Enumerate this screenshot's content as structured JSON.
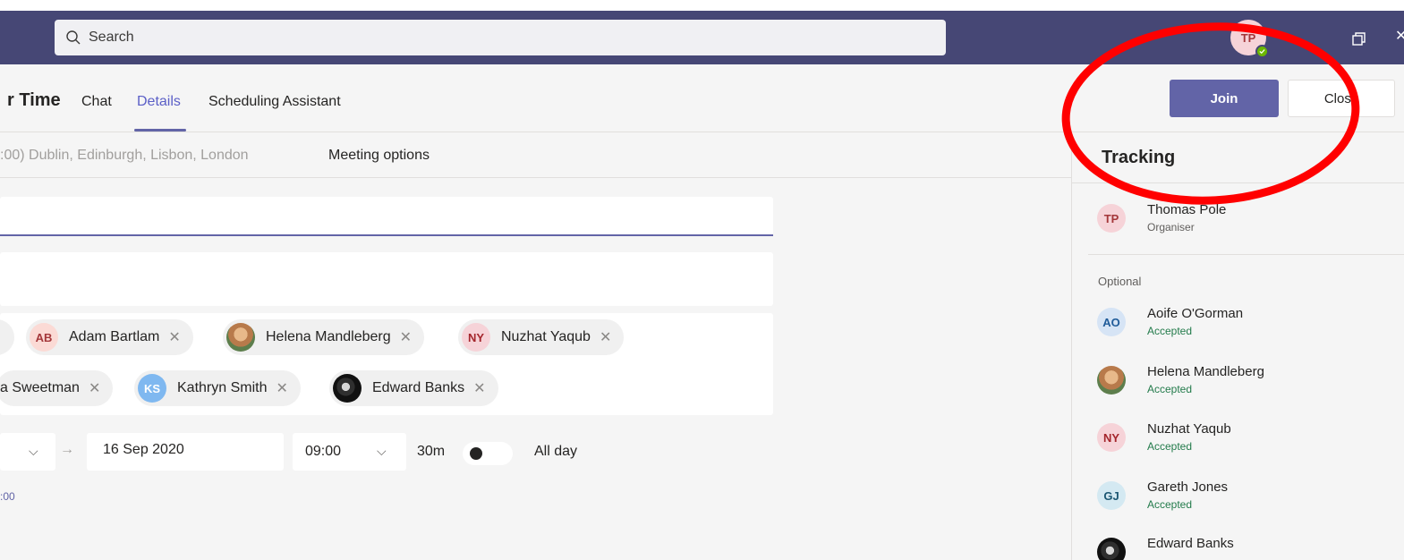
{
  "search": {
    "placeholder": "Search"
  },
  "user": {
    "initials": "TP"
  },
  "header": {
    "title": "r Time",
    "tabs": [
      {
        "label": "Chat"
      },
      {
        "label": "Details"
      },
      {
        "label": "Scheduling Assistant"
      }
    ],
    "join_label": "Join",
    "close_label": "Close"
  },
  "subheader": {
    "timezone": ":00) Dublin, Edinburgh, Lisbon, London",
    "meeting_options": "Meeting options"
  },
  "attendees": [
    {
      "initials": "AB",
      "name": "Adam Bartlam",
      "avatar_bg": "#fbdad5",
      "avatar_fg": "#a4373a"
    },
    {
      "initials": "",
      "name": "Helena Mandleberg",
      "photo": "woman"
    },
    {
      "initials": "NY",
      "name": "Nuzhat Yaqub",
      "avatar_bg": "#f6d3d8",
      "avatar_fg": "#a4262c"
    },
    {
      "initials": "",
      "name": "a Sweetman"
    },
    {
      "initials": "KS",
      "name": "Kathryn Smith",
      "avatar_bg": "#7fb8f0",
      "avatar_fg": "#ffffff"
    },
    {
      "initials": "",
      "name": "Edward Banks",
      "photo": "man"
    }
  ],
  "schedule": {
    "end_date": "16 Sep 2020",
    "start_time": "09:00",
    "duration": "30m",
    "all_day_label": "All day",
    "time_note": ":00"
  },
  "tracking": {
    "title": "Tracking",
    "organiser": {
      "initials": "TP",
      "name": "Thomas Pole",
      "status": "Organiser"
    },
    "optional_label": "Optional",
    "people": [
      {
        "initials": "AO",
        "name": "Aoife O'Gorman",
        "status": "Accepted",
        "avatar_bg": "#d6e4f5",
        "avatar_fg": "#1f5b99"
      },
      {
        "initials": "",
        "name": "Helena Mandleberg",
        "status": "Accepted",
        "photo": "woman"
      },
      {
        "initials": "NY",
        "name": "Nuzhat Yaqub",
        "status": "Accepted",
        "avatar_bg": "#f6d3d8",
        "avatar_fg": "#a4262c"
      },
      {
        "initials": "GJ",
        "name": "Gareth Jones",
        "status": "Accepted",
        "avatar_bg": "#d4e9f2",
        "avatar_fg": "#1c5773"
      },
      {
        "initials": "",
        "name": "Edward Banks",
        "status": "",
        "photo": "man"
      }
    ]
  },
  "colors": {
    "topbar": "#464775",
    "accent": "#6264a7",
    "accepted": "#237b4b",
    "annotation": "#ff0000"
  }
}
